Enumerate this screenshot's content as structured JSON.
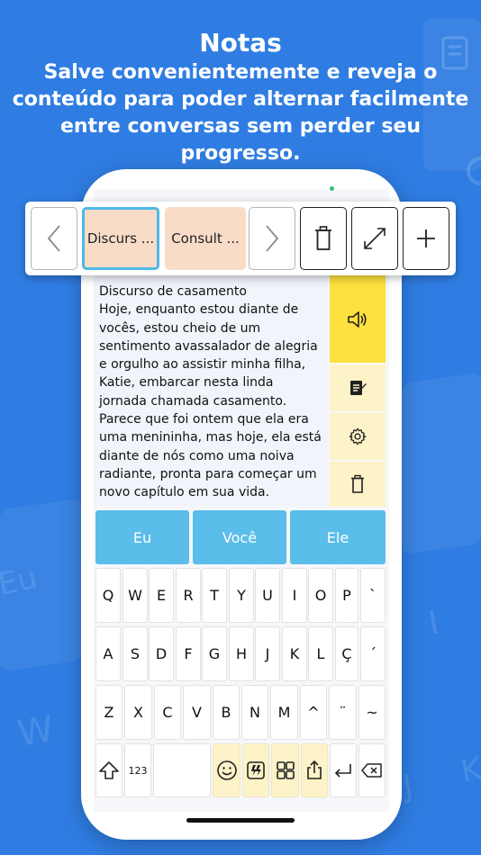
{
  "header": {
    "title": "Notas",
    "subtitle_lines": [
      "Salve convenientemente e reveja o",
      "conteúdo para poder alternar facilmente",
      "entre conversas sem perder seu progresso."
    ]
  },
  "background_letters": [
    "Eu",
    "W",
    "I",
    "J",
    "K"
  ],
  "toolbar": {
    "tabs": [
      {
        "label": "Discurs ...",
        "active": true
      },
      {
        "label": "Consult ...",
        "active": false
      }
    ]
  },
  "note": {
    "title": "Discurso de casamento",
    "body": "Hoje, enquanto estou diante de vocês, estou cheio de um sentimento avassalador de alegria e orgulho ao assistir minha filha, Katie, embarcar nesta linda jornada chamada casamento. Parece que foi ontem que ela era uma menininha, mas hoje, ela está diante de nós como uma noiva radiante, pronta para começar um novo capítulo em sua vida."
  },
  "side_buttons": [
    "speaker-icon",
    "notes-icon",
    "gear-icon",
    "trash-icon"
  ],
  "word_suggestions": [
    "Eu",
    "Você",
    "Ele"
  ],
  "keyboard": {
    "rows": [
      [
        "Q",
        "W",
        "E",
        "R",
        "T",
        "Y",
        "U",
        "I",
        "O",
        "P",
        "`"
      ],
      [
        "A",
        "S",
        "D",
        "F",
        "G",
        "H",
        "J",
        "K",
        "L",
        "Ç",
        "´"
      ],
      [
        "Z",
        "X",
        "C",
        "V",
        "B",
        "N",
        "M",
        "^",
        "¨",
        "~"
      ]
    ],
    "numbers_label": "123"
  },
  "colors": {
    "background": "#2f7de3",
    "tab": "#f8dcc8",
    "tab_active_border": "#4cb8e8",
    "speak_button": "#fee03e",
    "util_button": "#fdf3c8",
    "word_button": "#5bbde9"
  }
}
